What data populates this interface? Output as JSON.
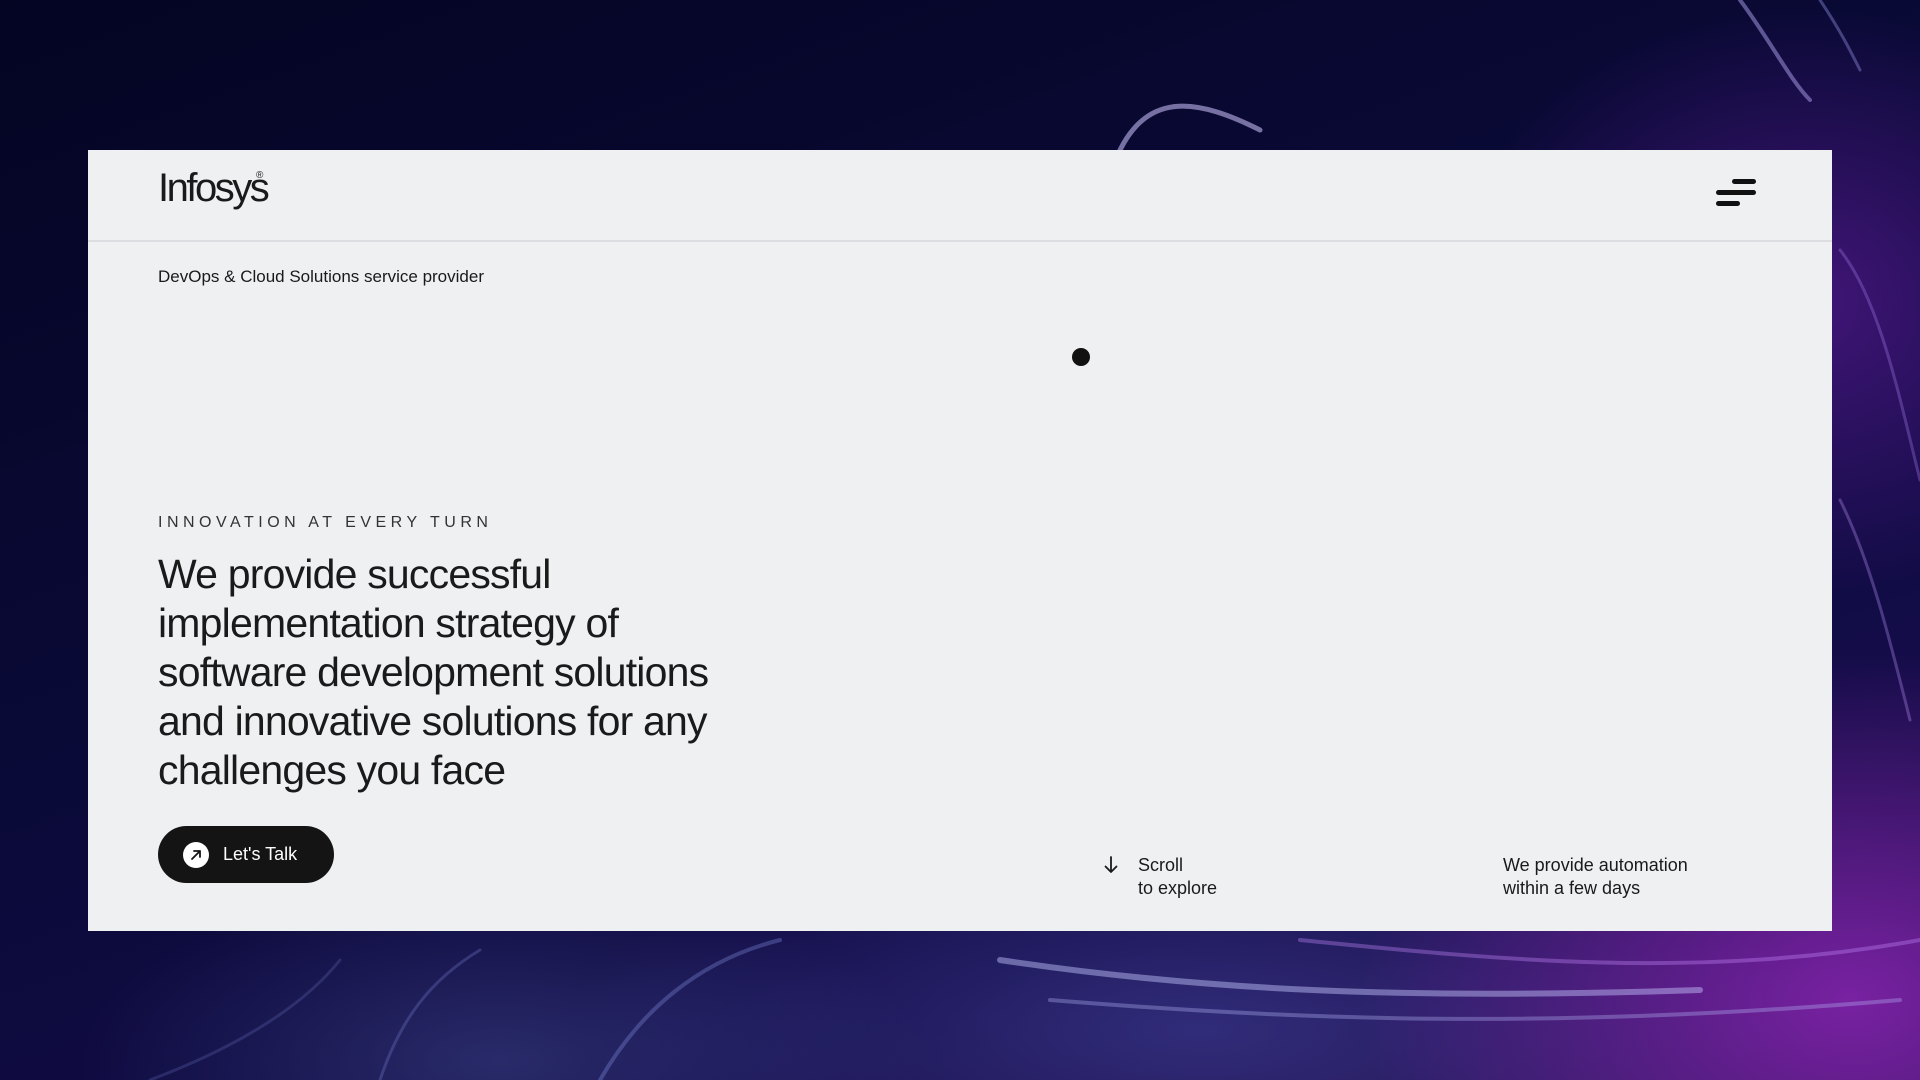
{
  "header": {
    "logo_text": "Infosys",
    "logo_reg": "®",
    "menu_icon": "hamburger-menu-icon"
  },
  "hero": {
    "subtitle": "DevOps & Cloud Solutions service provider",
    "eyebrow": "INNOVATION AT EVERY TURN",
    "headline_lines": [
      "We provide successful",
      "implementation strategy of",
      "software development solutions",
      "and innovative solutions for any",
      "challenges you face"
    ],
    "cta_label": "Let's Talk",
    "cta_icon": "arrow-up-right-icon"
  },
  "footer_hints": {
    "scroll_line1": "Scroll",
    "scroll_line2": "to explore",
    "scroll_icon": "arrow-down-icon",
    "automation_line1": "We provide automation",
    "automation_line2": "within a few days"
  },
  "colors": {
    "card_background": "#eff0f2",
    "text": "#1a1a1a",
    "button_background": "#141414",
    "backdrop_dark": "#040423",
    "backdrop_accent": "#9628be"
  }
}
